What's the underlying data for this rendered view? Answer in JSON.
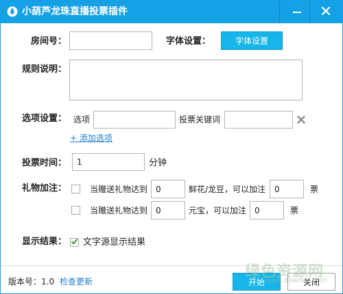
{
  "window": {
    "title": "小葫芦龙珠直播投票插件",
    "icons": {
      "app": "gourd-logo-icon",
      "minimize": "minimize-icon",
      "close": "close-icon"
    }
  },
  "room": {
    "label": "房间号：",
    "value": ""
  },
  "font": {
    "label": "字体设置：",
    "button": "字体设置"
  },
  "rules": {
    "label": "规则说明：",
    "value": ""
  },
  "options": {
    "label": "选项设置：",
    "option_label": "选项",
    "option_value": "",
    "keyword_label": "投票关键词",
    "keyword_value": "",
    "delete_icon": "delete-x-icon",
    "add_link": "+ 添加选项"
  },
  "vote_time": {
    "label": "投票时间：",
    "value": "1",
    "unit": "分钟"
  },
  "gift": {
    "label": "礼物加注：",
    "rule1": {
      "checked": false,
      "prefix": "当赠送礼物达到",
      "amount": "0",
      "middle": "鲜花/龙豆，可以加注",
      "votes": "0",
      "suffix": "票"
    },
    "rule2": {
      "checked": false,
      "prefix": "当赠送礼物达到",
      "amount": "0",
      "middle": "元宝，可以加注",
      "votes": "0",
      "suffix": "票"
    }
  },
  "display": {
    "label": "显示结果：",
    "checked": true,
    "option": "文字源显示结果"
  },
  "footer": {
    "version_label": "版本号：",
    "version": "1.0",
    "check_update": "检查更新",
    "start_button": "开始",
    "close_button": "关闭"
  },
  "watermark": {
    "text": "绿色资源网",
    "url": "www.downcc.com"
  },
  "colors": {
    "titlebar": "#14a1e6",
    "accent_button": "#16b5ea",
    "link": "#1f7fd0",
    "check": "#2e9a2e"
  }
}
